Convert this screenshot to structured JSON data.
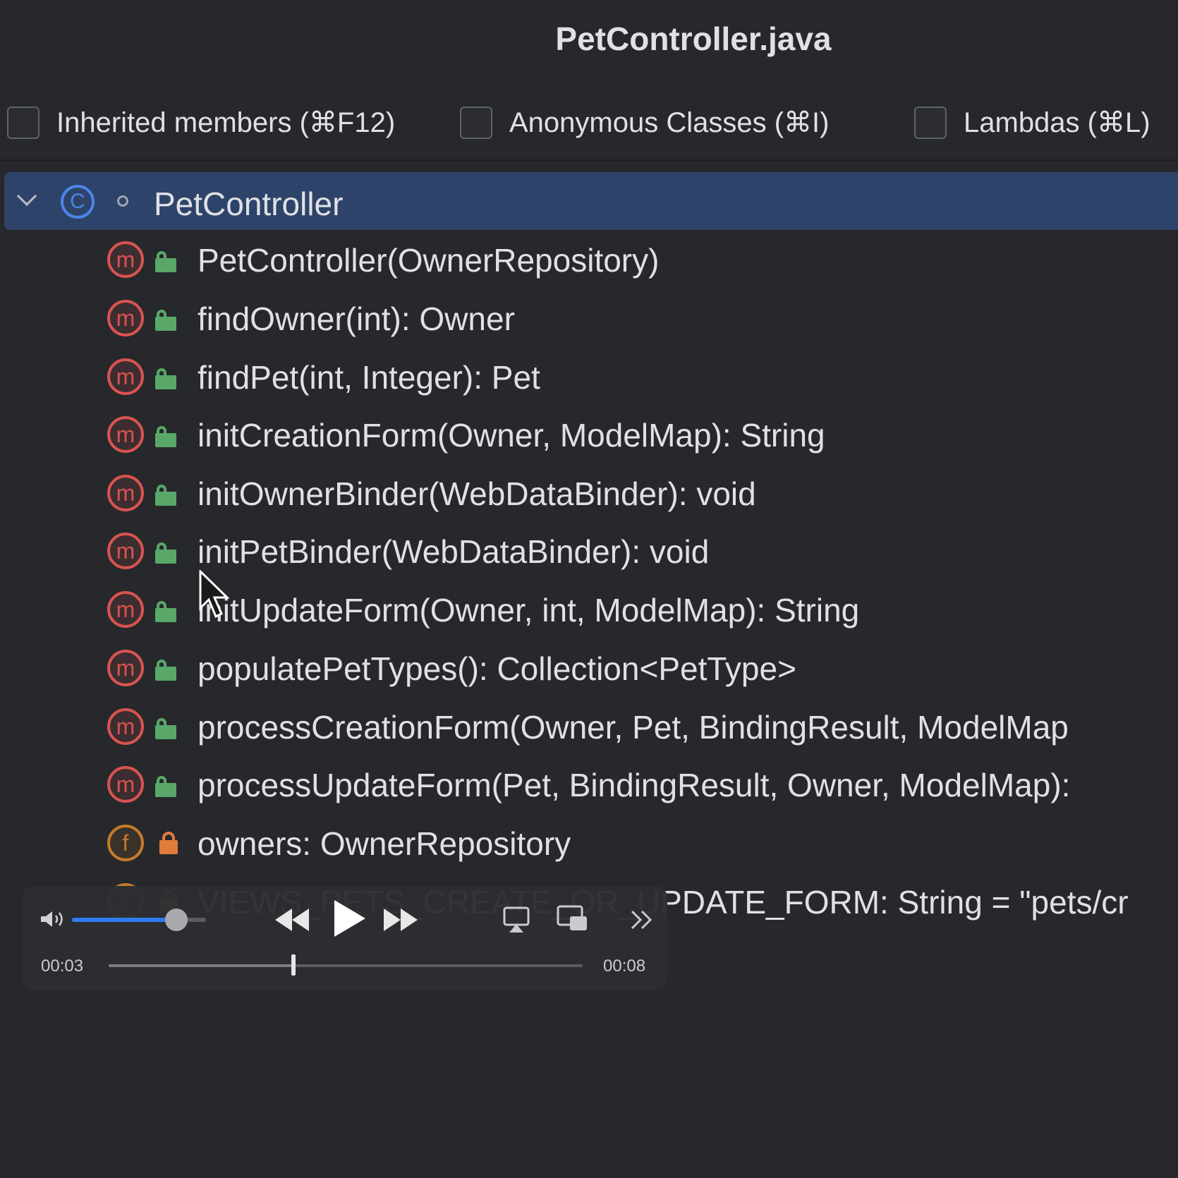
{
  "window": {
    "title": "PetController.java"
  },
  "filters": [
    {
      "label": "Inherited members (⌘F12)",
      "checked": false
    },
    {
      "label": "Anonymous Classes (⌘I)",
      "checked": false
    },
    {
      "label": "Lambdas (⌘L)",
      "checked": false
    }
  ],
  "tree": {
    "root": {
      "label": "PetController",
      "icon": "class-icon",
      "expanded": true,
      "selected": true
    },
    "members": [
      {
        "kind": "method",
        "access": "public",
        "label": "PetController(OwnerRepository)"
      },
      {
        "kind": "method",
        "access": "public",
        "label": "findOwner(int): Owner"
      },
      {
        "kind": "method",
        "access": "public",
        "label": "findPet(int, Integer): Pet"
      },
      {
        "kind": "method",
        "access": "public",
        "label": "initCreationForm(Owner, ModelMap): String"
      },
      {
        "kind": "method",
        "access": "public",
        "label": "initOwnerBinder(WebDataBinder): void"
      },
      {
        "kind": "method",
        "access": "public",
        "label": "initPetBinder(WebDataBinder): void"
      },
      {
        "kind": "method",
        "access": "public",
        "label": "initUpdateForm(Owner, int, ModelMap): String"
      },
      {
        "kind": "method",
        "access": "public",
        "label": "populatePetTypes(): Collection<PetType>"
      },
      {
        "kind": "method",
        "access": "public",
        "label": "processCreationForm(Owner, Pet, BindingResult, ModelMap"
      },
      {
        "kind": "method",
        "access": "public",
        "label": "processUpdateForm(Pet, BindingResult, Owner, ModelMap):"
      },
      {
        "kind": "field",
        "access": "private",
        "label": "owners: OwnerRepository"
      },
      {
        "kind": "field",
        "access": "private",
        "label": "VIEWS_PETS_CREATE_OR_UPDATE_FORM: String = \"pets/cr"
      }
    ]
  },
  "player": {
    "volume": 0.78,
    "current_time": "00:03",
    "total_time": "00:08",
    "progress": 0.39,
    "icons": [
      "speaker-icon",
      "rewind-icon",
      "play-icon",
      "fast-forward-icon",
      "airplay-icon",
      "picture-in-picture-icon",
      "more-chevrons-icon"
    ]
  },
  "colors": {
    "background": "#26282c",
    "selection": "#2e4369",
    "method_icon": "#d9534f",
    "field_icon": "#c57a2c",
    "public_lock": "#59a869",
    "private_lock": "#e07b39",
    "class_icon": "#4a86e8",
    "volume_fill": "#2f7bf5"
  }
}
